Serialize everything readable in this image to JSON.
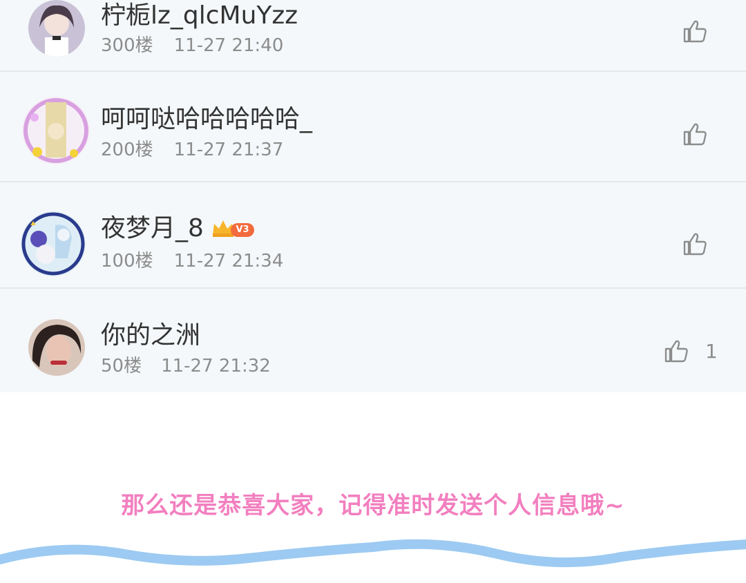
{
  "comments": [
    {
      "name": "柠栀lz_qlcMuYzz",
      "floor": "300楼",
      "time": "11-27 21:40",
      "like_count": "",
      "icon": "thumbs-up-icon"
    },
    {
      "name": "呵呵哒哈哈哈哈哈_",
      "floor": "200楼",
      "time": "11-27 21:37",
      "like_count": "",
      "icon": "thumbs-up-icon"
    },
    {
      "name": "夜梦月_8",
      "badge": "V3",
      "floor": "100楼",
      "time": "11-27 21:34",
      "like_count": "",
      "icon": "thumbs-up-icon"
    },
    {
      "name": "你的之洲",
      "floor": "50楼",
      "time": "11-27 21:32",
      "like_count": "1",
      "icon": "thumbs-up-icon"
    }
  ],
  "caption": "那么还是恭喜大家，记得准时发送个人信息哦~",
  "colors": {
    "caption": "#f27fbf",
    "wave": "#9ccaf2",
    "list_bg": "#f5f8fa",
    "badge": "#f26a3d",
    "crown": "#f7b52c"
  }
}
